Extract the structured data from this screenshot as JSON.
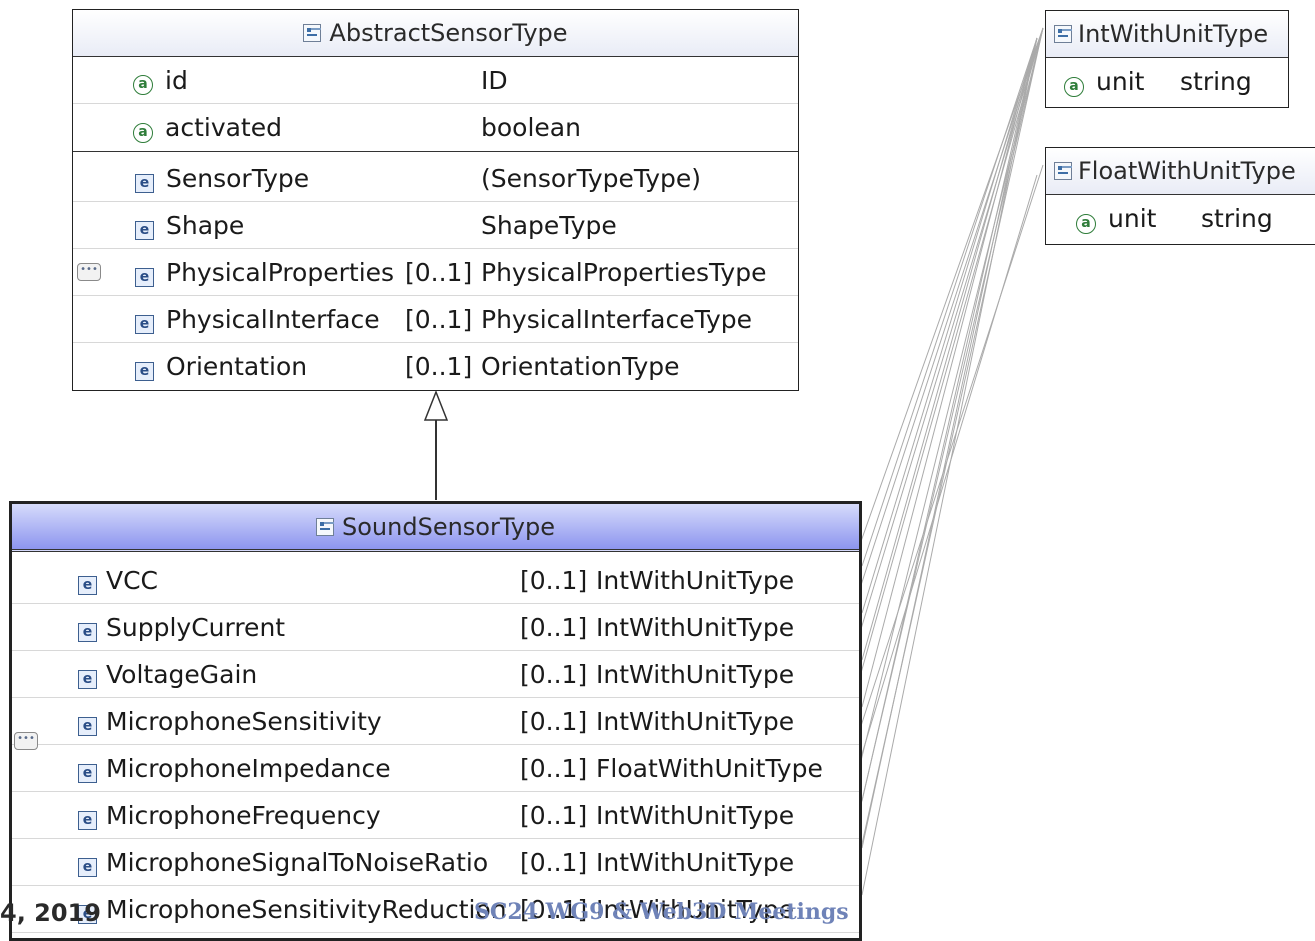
{
  "abstract": {
    "title": "AbstractSensorType",
    "attributes": [
      {
        "name": "id",
        "type": "ID"
      },
      {
        "name": "activated",
        "type": "boolean"
      }
    ],
    "elements": [
      {
        "name": "SensorType",
        "mult": "",
        "type": "(SensorTypeType)"
      },
      {
        "name": "Shape",
        "mult": "",
        "type": "ShapeType"
      },
      {
        "name": "PhysicalProperties",
        "mult": "[0..1]",
        "type": "PhysicalPropertiesType"
      },
      {
        "name": "PhysicalInterface",
        "mult": "[0..1]",
        "type": "PhysicalInterfaceType"
      },
      {
        "name": "Orientation",
        "mult": "[0..1]",
        "type": "OrientationType"
      }
    ]
  },
  "sound": {
    "title": "SoundSensorType",
    "elements": [
      {
        "name": "VCC",
        "mult": "[0..1]",
        "type": "IntWithUnitType"
      },
      {
        "name": "SupplyCurrent",
        "mult": "[0..1]",
        "type": "IntWithUnitType"
      },
      {
        "name": "VoltageGain",
        "mult": "[0..1]",
        "type": "IntWithUnitType"
      },
      {
        "name": "MicrophoneSensitivity",
        "mult": "[0..1]",
        "type": "IntWithUnitType"
      },
      {
        "name": "MicrophoneImpedance",
        "mult": "[0..1]",
        "type": "FloatWithUnitType"
      },
      {
        "name": "MicrophoneFrequency",
        "mult": "[0..1]",
        "type": "IntWithUnitType"
      },
      {
        "name": "MicrophoneSignalToNoiseRatio",
        "mult": "[0..1]",
        "type": "IntWithUnitType"
      },
      {
        "name": "MicrophoneSensitivityReduction",
        "mult": "[0..1]",
        "type": "IntWithUnitType"
      }
    ]
  },
  "int_type": {
    "title": "IntWithUnitType",
    "attr_name": "unit",
    "attr_type": "string"
  },
  "float_type": {
    "title": "FloatWithUnitType",
    "attr_name": "unit",
    "attr_type": "string"
  },
  "footer": {
    "left": "4, 2019",
    "center": "SC24 WG9 & Web3D Meetings"
  },
  "icons": {
    "attribute": "a",
    "element": "e",
    "sequence": "•••"
  },
  "colors": {
    "header_blue": "#8d95ef",
    "attr_green": "#2f7d3a",
    "element_blue": "#2a4d86"
  }
}
